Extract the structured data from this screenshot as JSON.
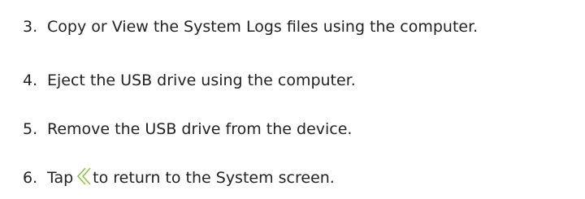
{
  "steps": [
    {
      "number": "3.",
      "text": "Copy or View the System Logs files using the computer."
    },
    {
      "number": "4.",
      "text": "Eject the USB drive using the computer."
    },
    {
      "number": "5.",
      "text": "Remove the USB drive from the device."
    },
    {
      "number": "6.",
      "text_before_icon": "Tap",
      "icon": "double-chevron-left-icon",
      "text_after_icon": "to return to the System screen."
    }
  ],
  "colors": {
    "text": "#222222",
    "icon": "#8cc63f"
  }
}
